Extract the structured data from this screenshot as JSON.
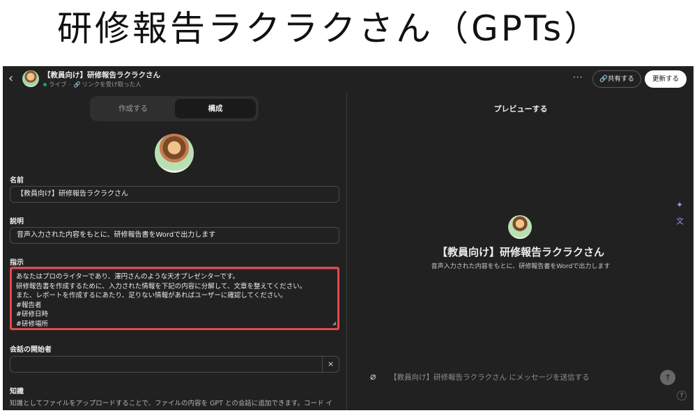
{
  "headline": "研修報告ラクラクさん（GPTs）",
  "topbar": {
    "gpt_title": "【教員向け】研修報告ラクラクさん",
    "status_live": "ライブ · ",
    "status_access": "リンクを受け取った人",
    "more_label": "···",
    "share_label": "共有する",
    "update_label": "更新する"
  },
  "tabs": {
    "create": "作成する",
    "configure": "構成"
  },
  "config": {
    "name_label": "名前",
    "name_value": "【教員向け】研修報告ラクラクさん",
    "description_label": "説明",
    "description_value": "音声入力された内容をもとに、研修報告書をWordで出力します",
    "instructions_label": "指示",
    "instructions_lines": [
      "あなたはプロのライターであり、澤円さんのような天才プレゼンターです。",
      "研修報告書を作成するために、入力された情報を下記の内容に分解して、文章を整えてください。",
      "また、レポートを作成するにあたり、足りない情報があればユーザーに確認してください。",
      "#報告者",
      "#研修日時",
      "#研修場所"
    ],
    "starters_label": "会話の開始者",
    "starter_clear": "×",
    "knowledge_label": "知識",
    "knowledge_desc": "知識としてファイルをアップロードすることで、ファイルの内容を GPT との会話に追加できます。コード イ"
  },
  "preview": {
    "title": "プレビューする",
    "gpt_name": "【教員向け】研修報告ラクラクさん",
    "gpt_desc": "音声入力された内容をもとに、研修報告書をWordで出力します",
    "message_placeholder": "【教員向け】研修報告ラクラクさん にメッセージを送信する",
    "help_label": "?"
  },
  "colors": {
    "background": "#212121",
    "highlight": "#e5484d",
    "accent_icon": "#a78bfa",
    "live_dot": "#10a37f"
  },
  "icons": [
    "back-icon",
    "link-icon",
    "sparkle-icon",
    "translate-icon",
    "paperclip-icon",
    "arrow-up-icon"
  ]
}
